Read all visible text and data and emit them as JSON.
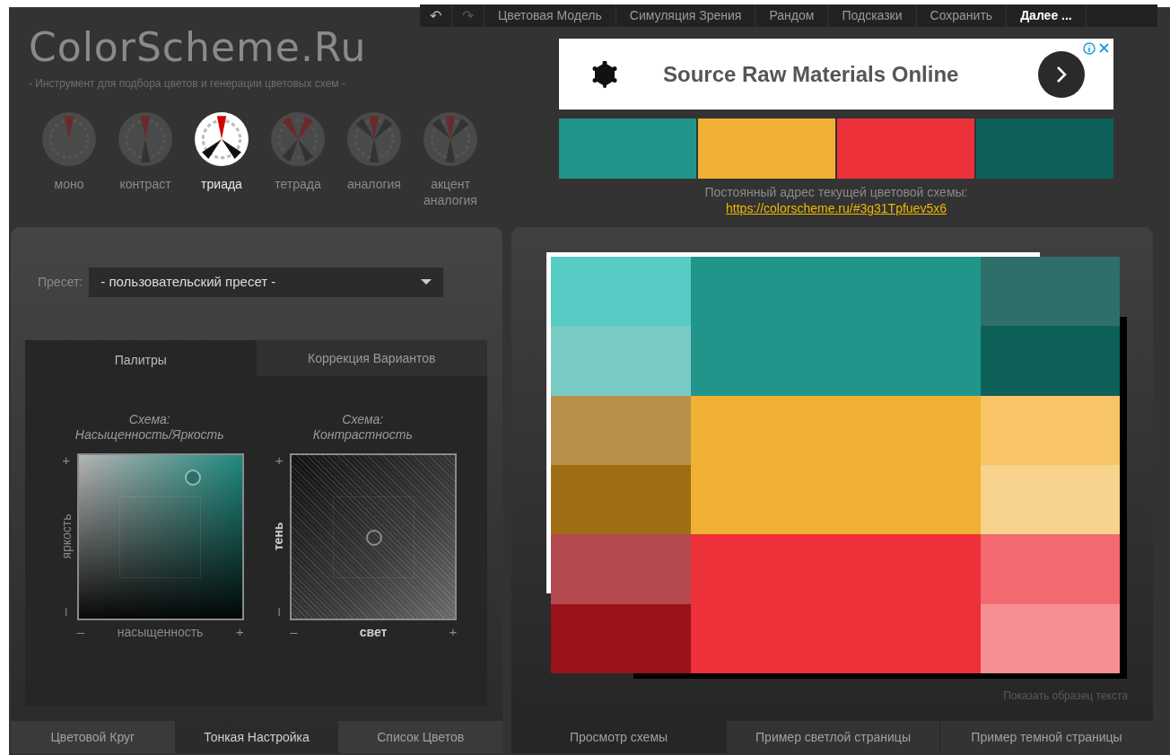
{
  "toolbar": {
    "items": [
      {
        "kind": "undo",
        "label": "↶",
        "disabled": false
      },
      {
        "kind": "redo",
        "label": "↷",
        "disabled": true
      },
      {
        "kind": "menu",
        "label": "Цветовая Модель",
        "bold": false
      },
      {
        "kind": "menu",
        "label": "Симуляция Зрения",
        "bold": false
      },
      {
        "kind": "menu",
        "label": "Рандом",
        "bold": false
      },
      {
        "kind": "menu",
        "label": "Подсказки",
        "bold": false
      },
      {
        "kind": "menu",
        "label": "Сохранить",
        "bold": false
      },
      {
        "kind": "menu",
        "label": "Далее ...",
        "bold": true
      }
    ]
  },
  "logo": {
    "title": "ColorScheme.Ru",
    "subtitle": "- Инструмент для подбора цветов и генерации цветовых схем -"
  },
  "modes": [
    {
      "kind": "mono",
      "label": "моно",
      "selected": false
    },
    {
      "kind": "contrast",
      "label": "контраст",
      "selected": false
    },
    {
      "kind": "triad",
      "label": "триада",
      "selected": true
    },
    {
      "kind": "tetrad",
      "label": "тетрада",
      "selected": false
    },
    {
      "kind": "analog",
      "label": "аналогия",
      "selected": false
    },
    {
      "kind": "accent",
      "label": "акцент аналогия",
      "selected": false
    }
  ],
  "ad": {
    "headline": "Source Raw Materials Online"
  },
  "swatches": [
    {
      "color": "#21958a"
    },
    {
      "color": "#f0b034"
    },
    {
      "color": "#ec313b"
    },
    {
      "color": "#0d6057"
    }
  ],
  "permalink": {
    "label": "Постоянный адрес текущей цветовой схемы:",
    "url": "https://colorscheme.ru/#3g31Tpfuev5x6"
  },
  "preset": {
    "label": "Пресет:",
    "value": "- пользовательский пресет -"
  },
  "inner_tabs": [
    {
      "label": "Палитры",
      "selected": true
    },
    {
      "label": "Коррекция Вариантов",
      "selected": false
    }
  ],
  "pads": [
    {
      "kind": "saturation",
      "title": [
        "Схема:",
        "Насыщенность/Яркость"
      ],
      "y_label": "яркость",
      "x_label": "насыщенность",
      "plus": "+",
      "minus": "–",
      "one": "I"
    },
    {
      "kind": "contrast",
      "title": [
        "Схема:",
        "Контрастность"
      ],
      "y_label": "тень",
      "x_label": "свет",
      "plus": "+",
      "minus": "–",
      "one": "I"
    }
  ],
  "left_tabs": [
    {
      "label": "Цветовой Круг",
      "selected": false
    },
    {
      "label": "Тонкая Настройка",
      "selected": true
    },
    {
      "label": "Список Цветов",
      "selected": false
    }
  ],
  "mosaic": [
    {
      "main": {
        "color": "#21958a"
      },
      "left": [
        {
          "color": "#55cbc4"
        },
        {
          "color": "#78cbc4"
        }
      ],
      "right": [
        {
          "color": "#2e6f69"
        },
        {
          "color": "#0d6057"
        }
      ]
    },
    {
      "main": {
        "color": "#f0b034"
      },
      "left": [
        {
          "color": "#b8904a"
        },
        {
          "color": "#a06e12"
        }
      ],
      "right": [
        {
          "color": "#f7c565"
        },
        {
          "color": "#f7d38d"
        }
      ]
    },
    {
      "main": {
        "color": "#ec313b"
      },
      "left": [
        {
          "color": "#b44a4f"
        },
        {
          "color": "#9b1219"
        }
      ],
      "right": [
        {
          "color": "#f3696f"
        },
        {
          "color": "#f58f93"
        }
      ]
    }
  ],
  "sample_text_link": "Показать образец текста",
  "right_tabs": [
    {
      "label": "Просмотр схемы",
      "selected": true
    },
    {
      "label": "Пример светлой страницы",
      "selected": false
    },
    {
      "label": "Пример темной страницы",
      "selected": false
    }
  ]
}
